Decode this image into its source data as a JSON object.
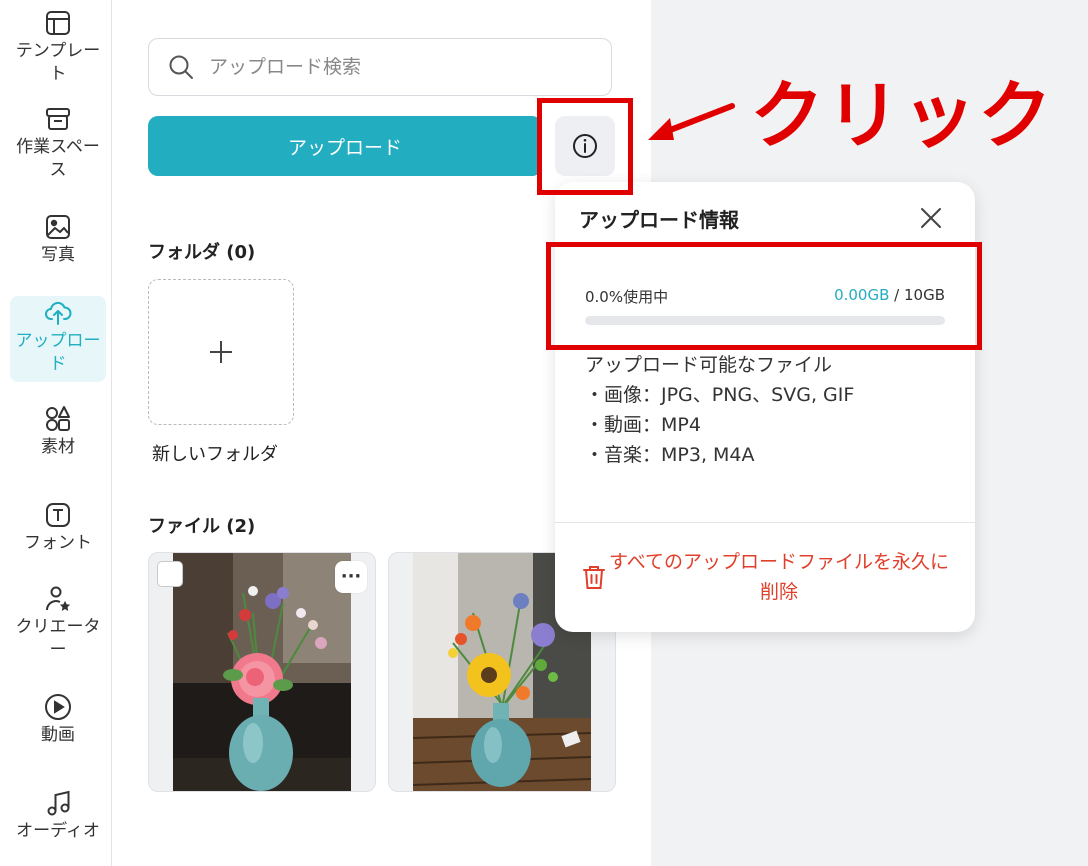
{
  "sidebar": {
    "items": [
      {
        "label": "テンプレート",
        "icon": "template-icon"
      },
      {
        "label": "作業スペース",
        "icon": "archive-box-icon"
      },
      {
        "label": "写真",
        "icon": "image-icon"
      },
      {
        "label": "アップロード",
        "icon": "cloud-upload-icon",
        "active": true
      },
      {
        "label": "素材",
        "icon": "shapes-icon"
      },
      {
        "label": "フォント",
        "icon": "text-t-icon"
      },
      {
        "label": "クリエーター",
        "icon": "creator-user-icon"
      },
      {
        "label": "動画",
        "icon": "play-circle-icon"
      },
      {
        "label": "オーディオ",
        "icon": "music-note-icon"
      }
    ]
  },
  "upload_panel": {
    "search_placeholder": "アップロード検索",
    "upload_button_label": "アップロード",
    "folders_title": "フォルダ (0)",
    "new_folder_label": "新しいフォルダ",
    "files_title": "ファイル (2)",
    "more_glyph": "···"
  },
  "popover": {
    "title": "アップロード情報",
    "usage_text": "0.0%使用中",
    "used_amount": "0.00GB",
    "separator": " / ",
    "total_amount": "10GB",
    "usage_fraction": 0.0,
    "files_heading": "アップロード可能なファイル",
    "file_types": [
      "・画像：JPG、PNG、SVG, GIF",
      "・動画：MP4",
      "・音楽：MP3, M4A"
    ],
    "delete_label": "すべてのアップロードファイルを永久に削除"
  },
  "annotation": {
    "callout_text": "クリック"
  },
  "colors": {
    "accent": "#22adc0",
    "danger": "#e0402b",
    "annotation_red": "#e00000"
  }
}
